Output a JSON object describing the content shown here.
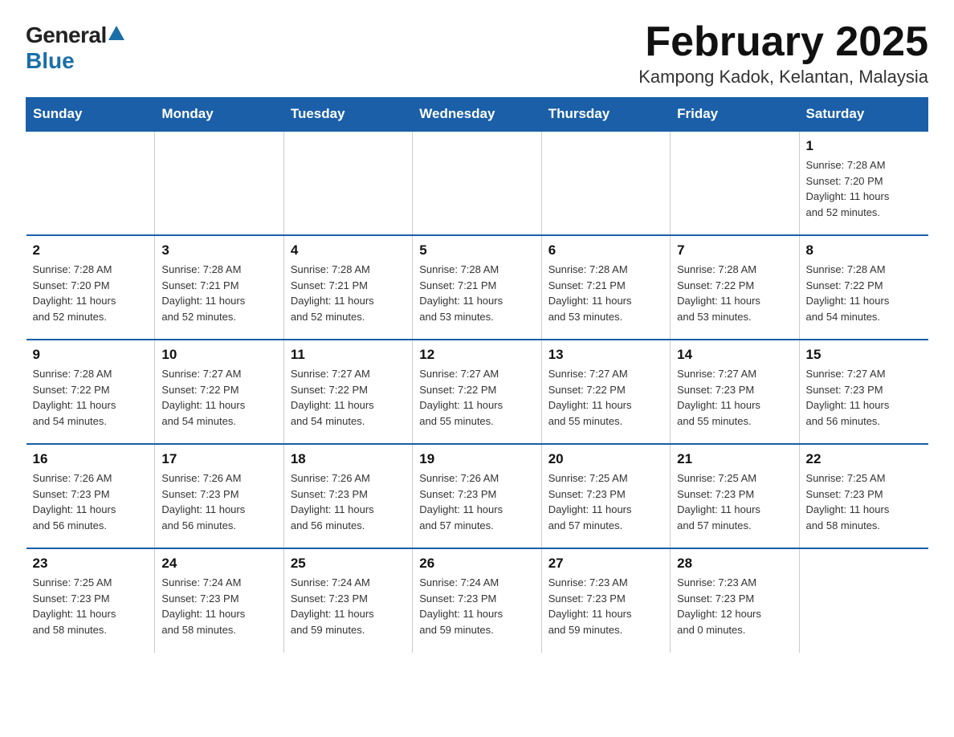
{
  "logo": {
    "general": "General",
    "blue": "Blue"
  },
  "header": {
    "title": "February 2025",
    "subtitle": "Kampong Kadok, Kelantan, Malaysia"
  },
  "days_of_week": [
    "Sunday",
    "Monday",
    "Tuesday",
    "Wednesday",
    "Thursday",
    "Friday",
    "Saturday"
  ],
  "weeks": [
    [
      {
        "day": "",
        "info": ""
      },
      {
        "day": "",
        "info": ""
      },
      {
        "day": "",
        "info": ""
      },
      {
        "day": "",
        "info": ""
      },
      {
        "day": "",
        "info": ""
      },
      {
        "day": "",
        "info": ""
      },
      {
        "day": "1",
        "info": "Sunrise: 7:28 AM\nSunset: 7:20 PM\nDaylight: 11 hours\nand 52 minutes."
      }
    ],
    [
      {
        "day": "2",
        "info": "Sunrise: 7:28 AM\nSunset: 7:20 PM\nDaylight: 11 hours\nand 52 minutes."
      },
      {
        "day": "3",
        "info": "Sunrise: 7:28 AM\nSunset: 7:21 PM\nDaylight: 11 hours\nand 52 minutes."
      },
      {
        "day": "4",
        "info": "Sunrise: 7:28 AM\nSunset: 7:21 PM\nDaylight: 11 hours\nand 52 minutes."
      },
      {
        "day": "5",
        "info": "Sunrise: 7:28 AM\nSunset: 7:21 PM\nDaylight: 11 hours\nand 53 minutes."
      },
      {
        "day": "6",
        "info": "Sunrise: 7:28 AM\nSunset: 7:21 PM\nDaylight: 11 hours\nand 53 minutes."
      },
      {
        "day": "7",
        "info": "Sunrise: 7:28 AM\nSunset: 7:22 PM\nDaylight: 11 hours\nand 53 minutes."
      },
      {
        "day": "8",
        "info": "Sunrise: 7:28 AM\nSunset: 7:22 PM\nDaylight: 11 hours\nand 54 minutes."
      }
    ],
    [
      {
        "day": "9",
        "info": "Sunrise: 7:28 AM\nSunset: 7:22 PM\nDaylight: 11 hours\nand 54 minutes."
      },
      {
        "day": "10",
        "info": "Sunrise: 7:27 AM\nSunset: 7:22 PM\nDaylight: 11 hours\nand 54 minutes."
      },
      {
        "day": "11",
        "info": "Sunrise: 7:27 AM\nSunset: 7:22 PM\nDaylight: 11 hours\nand 54 minutes."
      },
      {
        "day": "12",
        "info": "Sunrise: 7:27 AM\nSunset: 7:22 PM\nDaylight: 11 hours\nand 55 minutes."
      },
      {
        "day": "13",
        "info": "Sunrise: 7:27 AM\nSunset: 7:22 PM\nDaylight: 11 hours\nand 55 minutes."
      },
      {
        "day": "14",
        "info": "Sunrise: 7:27 AM\nSunset: 7:23 PM\nDaylight: 11 hours\nand 55 minutes."
      },
      {
        "day": "15",
        "info": "Sunrise: 7:27 AM\nSunset: 7:23 PM\nDaylight: 11 hours\nand 56 minutes."
      }
    ],
    [
      {
        "day": "16",
        "info": "Sunrise: 7:26 AM\nSunset: 7:23 PM\nDaylight: 11 hours\nand 56 minutes."
      },
      {
        "day": "17",
        "info": "Sunrise: 7:26 AM\nSunset: 7:23 PM\nDaylight: 11 hours\nand 56 minutes."
      },
      {
        "day": "18",
        "info": "Sunrise: 7:26 AM\nSunset: 7:23 PM\nDaylight: 11 hours\nand 56 minutes."
      },
      {
        "day": "19",
        "info": "Sunrise: 7:26 AM\nSunset: 7:23 PM\nDaylight: 11 hours\nand 57 minutes."
      },
      {
        "day": "20",
        "info": "Sunrise: 7:25 AM\nSunset: 7:23 PM\nDaylight: 11 hours\nand 57 minutes."
      },
      {
        "day": "21",
        "info": "Sunrise: 7:25 AM\nSunset: 7:23 PM\nDaylight: 11 hours\nand 57 minutes."
      },
      {
        "day": "22",
        "info": "Sunrise: 7:25 AM\nSunset: 7:23 PM\nDaylight: 11 hours\nand 58 minutes."
      }
    ],
    [
      {
        "day": "23",
        "info": "Sunrise: 7:25 AM\nSunset: 7:23 PM\nDaylight: 11 hours\nand 58 minutes."
      },
      {
        "day": "24",
        "info": "Sunrise: 7:24 AM\nSunset: 7:23 PM\nDaylight: 11 hours\nand 58 minutes."
      },
      {
        "day": "25",
        "info": "Sunrise: 7:24 AM\nSunset: 7:23 PM\nDaylight: 11 hours\nand 59 minutes."
      },
      {
        "day": "26",
        "info": "Sunrise: 7:24 AM\nSunset: 7:23 PM\nDaylight: 11 hours\nand 59 minutes."
      },
      {
        "day": "27",
        "info": "Sunrise: 7:23 AM\nSunset: 7:23 PM\nDaylight: 11 hours\nand 59 minutes."
      },
      {
        "day": "28",
        "info": "Sunrise: 7:23 AM\nSunset: 7:23 PM\nDaylight: 12 hours\nand 0 minutes."
      },
      {
        "day": "",
        "info": ""
      }
    ]
  ]
}
